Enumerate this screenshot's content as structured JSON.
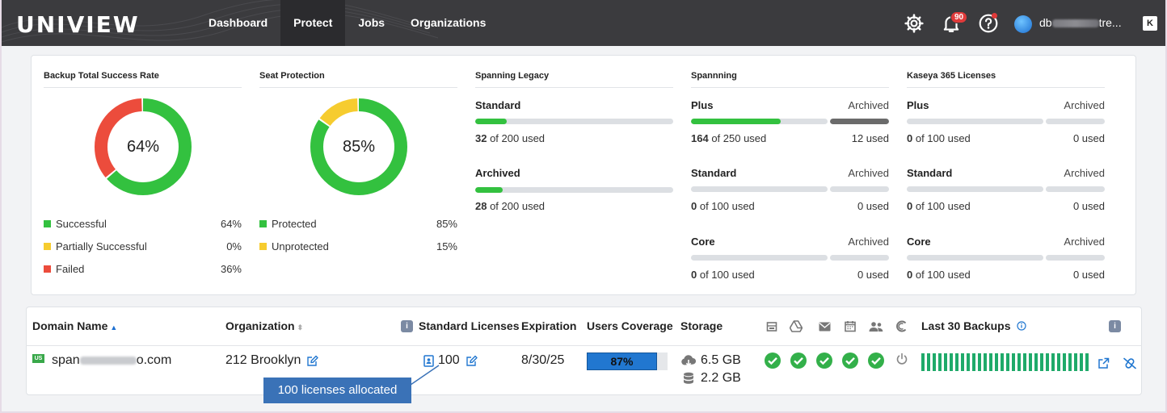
{
  "app": {
    "logo": "UNIVIEW"
  },
  "nav": {
    "items": [
      "Dashboard",
      "Protect",
      "Jobs",
      "Organizations"
    ],
    "active": "Protect"
  },
  "topbar": {
    "notifications_count": "90",
    "user_prefix": "db",
    "user_suffix": "tre..."
  },
  "widgets": {
    "backup": {
      "title": "Backup Total Success Rate",
      "center": "64%",
      "legend": [
        {
          "label": "Successful",
          "value": "64%",
          "color": "#33c13f"
        },
        {
          "label": "Partially Successful",
          "value": "0%",
          "color": "#f6cc2f"
        },
        {
          "label": "Failed",
          "value": "36%",
          "color": "#ec4c3c"
        }
      ]
    },
    "seat": {
      "title": "Seat Protection",
      "center": "85%",
      "legend": [
        {
          "label": "Protected",
          "value": "85%",
          "color": "#33c13f"
        },
        {
          "label": "Unprotected",
          "value": "15%",
          "color": "#f6cc2f"
        }
      ]
    },
    "legacy": {
      "title": "Spanning Legacy",
      "rows": [
        {
          "name": "Standard",
          "used_num": "32",
          "used_rest": " of 200 used",
          "fraction": 0.16
        },
        {
          "name": "Archived",
          "used_num": "28",
          "used_rest": " of 200 used",
          "fraction": 0.14
        }
      ]
    },
    "spanning": {
      "title": "Spannning",
      "rows": [
        {
          "name": "Plus",
          "archived": "Archived",
          "used_num": "164",
          "used_rest": " of 250 used",
          "arch_used": "12 used",
          "fraction": 0.656,
          "arch_fraction": 1.0
        },
        {
          "name": "Standard",
          "archived": "Archived",
          "used_num": "0",
          "used_rest": " of 100 used",
          "arch_used": "0 used",
          "fraction": 0,
          "arch_fraction": 0
        },
        {
          "name": "Core",
          "archived": "Archived",
          "used_num": "0",
          "used_rest": " of 100 used",
          "arch_used": "0 used",
          "fraction": 0,
          "arch_fraction": 0
        }
      ]
    },
    "kaseya": {
      "title": "Kaseya 365 Licenses",
      "rows": [
        {
          "name": "Plus",
          "archived": "Archived",
          "used_num": "0",
          "used_rest": " of 100 used",
          "arch_used": "0 used",
          "fraction": 0,
          "arch_fraction": 0
        },
        {
          "name": "Standard",
          "archived": "Archived",
          "used_num": "0",
          "used_rest": " of 100 used",
          "arch_used": "0 used",
          "fraction": 0,
          "arch_fraction": 0
        },
        {
          "name": "Core",
          "archived": "Archived",
          "used_num": "0",
          "used_rest": " of 100 used",
          "arch_used": "0 used",
          "fraction": 0,
          "arch_fraction": 0
        }
      ]
    }
  },
  "table": {
    "headers": {
      "domain": "Domain Name",
      "organization": "Organization",
      "licenses": "Standard Licenses",
      "expiration": "Expiration",
      "coverage": "Users Coverage",
      "storage": "Storage",
      "last30": "Last 30 Backups"
    },
    "row": {
      "flag": "US",
      "domain_prefix": "span",
      "domain_suffix": "o.com",
      "organization": "212 Brooklyn",
      "licenses": "100",
      "expiration": "8/30/25",
      "coverage": "87%",
      "coverage_fraction": 0.87,
      "storage_cloud": "6.5 GB",
      "storage_local": "2.2 GB"
    }
  },
  "tooltip": {
    "text": "100 licenses allocated"
  },
  "colors": {
    "green": "#33c13f",
    "accent": "#2177d0",
    "archived_fill": "#6b6b6b"
  }
}
